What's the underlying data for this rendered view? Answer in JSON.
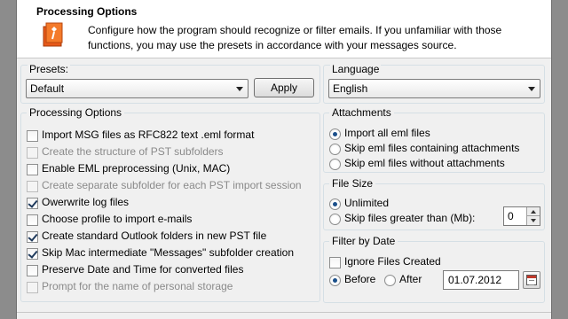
{
  "header": {
    "title": "Processing Options",
    "description": "Configure how the program should recognize or filter emails. If you unfamiliar with those functions, you may use the presets in accordance with your messages source.",
    "icon": "wizard-icon"
  },
  "presets": {
    "label": "Presets:",
    "selected": "Default",
    "apply_label": "Apply"
  },
  "language": {
    "label": "Language",
    "selected": "English"
  },
  "processing": {
    "label": "Processing Options",
    "items": [
      {
        "label": "Import MSG files as RFC822 text .eml format",
        "checked": false,
        "enabled": true
      },
      {
        "label": "Create the structure of PST subfolders",
        "checked": false,
        "enabled": false
      },
      {
        "label": "Enable EML preprocessing (Unix, MAC)",
        "checked": false,
        "enabled": true
      },
      {
        "label": "Create separate subfolder for each PST import session",
        "checked": false,
        "enabled": false
      },
      {
        "label": "Owerwrite log files",
        "checked": true,
        "enabled": true
      },
      {
        "label": "Choose profile to import e-mails",
        "checked": false,
        "enabled": true
      },
      {
        "label": "Create standard Outlook folders in new PST file",
        "checked": true,
        "enabled": true
      },
      {
        "label": "Skip Mac intermediate \"Messages\" subfolder creation",
        "checked": true,
        "enabled": true
      },
      {
        "label": "Preserve Date and Time for converted files",
        "checked": false,
        "enabled": true
      },
      {
        "label": "Prompt for the name of personal storage",
        "checked": false,
        "enabled": false
      }
    ]
  },
  "attachments": {
    "label": "Attachments",
    "options": [
      {
        "label": "Import all eml files",
        "checked": true
      },
      {
        "label": "Skip eml files containing attachments",
        "checked": false
      },
      {
        "label": "Skip eml files without attachments",
        "checked": false
      }
    ]
  },
  "filesize": {
    "label": "File Size",
    "unlimited_label": "Unlimited",
    "unlimited_checked": true,
    "skip_label": "Skip files greater than (Mb):",
    "skip_checked": false,
    "value": "0"
  },
  "filterdate": {
    "label": "Filter by Date",
    "ignore_label": "Ignore Files Created",
    "ignore_checked": false,
    "before_label": "Before",
    "before_checked": true,
    "after_label": "After",
    "after_checked": false,
    "date": "01.07.2012"
  }
}
